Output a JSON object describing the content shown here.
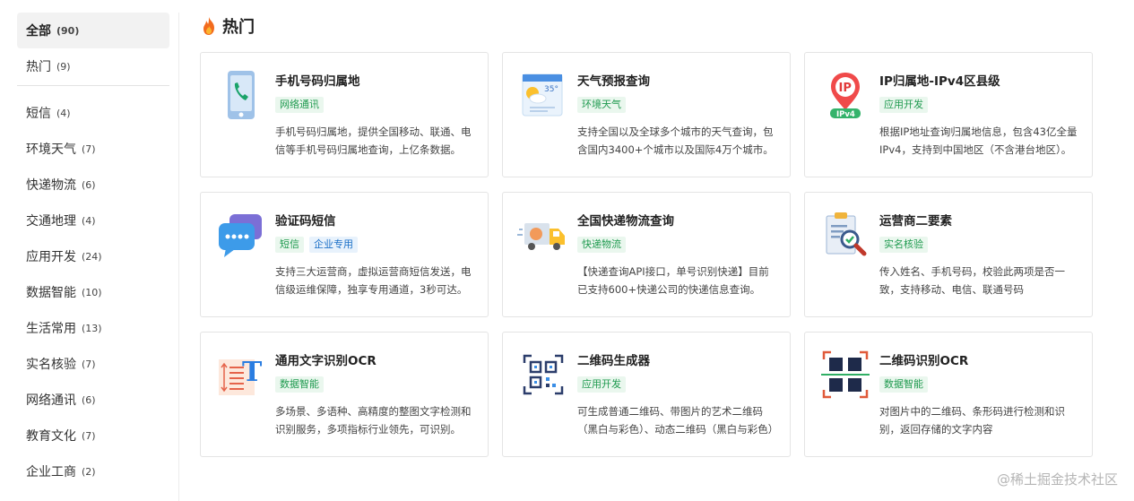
{
  "sidebar": {
    "items": [
      {
        "label": "全部",
        "count": "(90)"
      },
      {
        "label": "热门",
        "count": "(9)"
      },
      {
        "label": "短信",
        "count": "(4)"
      },
      {
        "label": "环境天气",
        "count": "(7)"
      },
      {
        "label": "快递物流",
        "count": "(6)"
      },
      {
        "label": "交通地理",
        "count": "(4)"
      },
      {
        "label": "应用开发",
        "count": "(24)"
      },
      {
        "label": "数据智能",
        "count": "(10)"
      },
      {
        "label": "生活常用",
        "count": "(13)"
      },
      {
        "label": "实名核验",
        "count": "(7)"
      },
      {
        "label": "网络通讯",
        "count": "(6)"
      },
      {
        "label": "教育文化",
        "count": "(7)"
      },
      {
        "label": "企业工商",
        "count": "(2)"
      }
    ]
  },
  "section": {
    "title": "热门",
    "icon": "fire-icon"
  },
  "cards": [
    {
      "name": "手机号码归属地",
      "tags": [
        "网络通讯"
      ],
      "tag2": "",
      "desc": "手机号码归属地，提供全国移动、联通、电信等手机号码归属地查询，上亿条数据。",
      "icon": "phone-location-icon"
    },
    {
      "name": "天气预报查询",
      "tags": [
        "环境天气"
      ],
      "tag2": "",
      "desc": "支持全国以及全球多个城市的天气查询，包含国内3400+个城市以及国际4万个城市。",
      "icon": "weather-icon"
    },
    {
      "name": "IP归属地-IPv4区县级",
      "tags": [
        "应用开发"
      ],
      "tag2": "",
      "desc": "根据IP地址查询归属地信息，包含43亿全量IPv4，支持到中国地区（不含港台地区）。",
      "icon": "ip-location-icon",
      "icon_text": "IP",
      "icon_badge": "IPv4"
    },
    {
      "name": "验证码短信",
      "tags": [
        "短信"
      ],
      "tag2": "企业专用",
      "desc": "支持三大运营商，虚拟运营商短信发送，电信级运维保障，独享专用通道，3秒可达。",
      "icon": "sms-icon"
    },
    {
      "name": "全国快递物流查询",
      "tags": [
        "快递物流"
      ],
      "tag2": "",
      "desc": "【快递查询API接口，单号识别快递】目前已支持600+快递公司的快递信息查询。",
      "icon": "delivery-truck-icon"
    },
    {
      "name": "运营商二要素",
      "tags": [
        "实名核验"
      ],
      "tag2": "",
      "desc": "传入姓名、手机号码，校验此两项是否一致，支持移动、电信、联通号码",
      "icon": "verify-document-icon"
    },
    {
      "name": "通用文字识别OCR",
      "tags": [
        "数据智能"
      ],
      "tag2": "",
      "desc": "多场景、多语种、高精度的整图文字检测和识别服务，多项指标行业领先，可识别。",
      "icon": "text-ocr-icon",
      "icon_text": "T"
    },
    {
      "name": "二维码生成器",
      "tags": [
        "应用开发"
      ],
      "tag2": "",
      "desc": "可生成普通二维码、带图片的艺术二维码（黑白与彩色）、动态二维码（黑白与彩色）",
      "icon": "qr-generate-icon"
    },
    {
      "name": "二维码识别OCR",
      "tags": [
        "数据智能"
      ],
      "tag2": "",
      "desc": "对图片中的二维码、条形码进行检测和识别，返回存储的文字内容",
      "icon": "qr-scan-icon"
    }
  ],
  "weather_icon_text": "35°",
  "watermark": "@稀土掘金技术社区",
  "colors": {
    "tag_green_bg": "#eaf7ee",
    "tag_green_text": "#1f9a4f",
    "tag_blue_bg": "#e8f2fc",
    "tag_blue_text": "#1a6fc7",
    "active_bg": "#f2f2f2"
  }
}
